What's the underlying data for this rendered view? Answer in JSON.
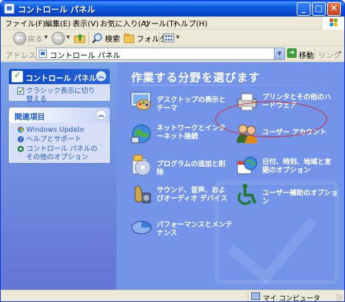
{
  "window": {
    "title": "コントロール パネル"
  },
  "menubar": {
    "items": [
      "ファイル(F)",
      "編集(E)",
      "表示(V)",
      "お気に入り(A)",
      "ツール(T)",
      "ヘルプ(H)"
    ]
  },
  "toolbar": {
    "back": "戻る",
    "search": "検索",
    "folders": "フォルダ"
  },
  "addressbar": {
    "label": "アドレス(D)",
    "value": "コントロール パネル",
    "go": "移動",
    "links": "リンク"
  },
  "sidebar": {
    "panel_title": "コントロール パネル",
    "switch_view": "クラシック表示に切り替える",
    "see_also_title": "関連項目",
    "links": [
      "Windows Update",
      "ヘルプとサポート",
      "コントロール パネルのその他のオプション"
    ]
  },
  "main": {
    "heading": "作業する分野を選びます",
    "categories": [
      "デスクトップの表示とテーマ",
      "プリンタとその他のハードウェア",
      "ネットワークとインターネット接続",
      "ユーザー アカウント",
      "プログラムの追加と削除",
      "日付、時刻、地域と言語のオプション",
      "サウンド、音声、およびオーディオ デバイス",
      "ユーザー補助のオプション",
      "パフォーマンスとメンテナンス"
    ]
  },
  "statusbar": {
    "text": "マイ コンピュータ"
  },
  "colors": {
    "xp_blue": "#0b5bdc",
    "content_bg": "#7394e8",
    "highlight_oval": "#dd2222"
  }
}
